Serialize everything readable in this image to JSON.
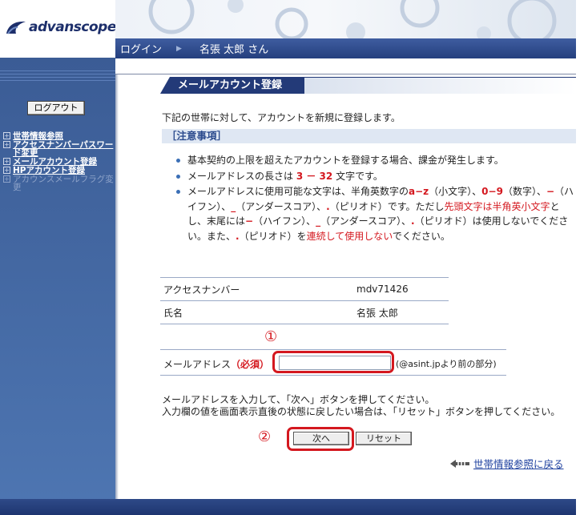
{
  "header": {
    "logo_text": "advanscope",
    "nav_login": "ログイン",
    "user_name": "名張 太郎 さん",
    "accent": "#233a78"
  },
  "sidebar": {
    "logout_label": "ログアウト",
    "items": [
      {
        "label": "世帯情報参照",
        "enabled": true
      },
      {
        "label": "アクセスナンバーパスワード変更",
        "enabled": true
      },
      {
        "label": "メールアカウント登録",
        "enabled": true
      },
      {
        "label": "HPアカウント登録",
        "enabled": true
      },
      {
        "label": "アカウンスメールフラグ変更",
        "enabled": false
      }
    ]
  },
  "main": {
    "title": "メールアカウント登録",
    "intro": "下記の世帯に対して、アカウントを新規に登録します。",
    "notice_heading": "［注意事項］",
    "notices": {
      "n1": "基本契約の上限を超えたアカウントを登録する場合、課金が発生します。",
      "n2_pre": "メールアドレスの長さは",
      "n2_val": "3 － 32",
      "n2_post": "文字です。",
      "n3_a": "メールアドレスに使用可能な文字は、半角英数字の",
      "n3_az": "a−z",
      "n3_b": "（小文字）、",
      "n3_09": "0−9",
      "n3_c": "（数字）、",
      "n3_hy": "−",
      "n3_d": "（ハイフン）、",
      "n3_us": "_",
      "n3_e": "（アンダースコア）、",
      "n3_dot": ".",
      "n3_f": "（ピリオド）です。ただし",
      "n3_head": "先頭文字は半角英小文字",
      "n3_g": "とし、末尾には",
      "n3_hy2": "−",
      "n3_h": "（ハイフン）、",
      "n3_us2": "_",
      "n3_i": "（アンダースコア）、",
      "n3_dot2": ".",
      "n3_j": "（ピリオド）は使用しないでください。また、",
      "n3_dot3": ".",
      "n3_k": "（ピリオド）を",
      "n3_cont": "連続して使用しない",
      "n3_l": "でください。"
    },
    "info": {
      "access_label": "アクセスナンバー",
      "access_value": "mdv71426",
      "name_label": "氏名",
      "name_value": "名張 太郎"
    },
    "mail": {
      "label": "メールアドレス",
      "required": "（必須）",
      "value": "",
      "hint": "(@asint.jpより前の部分)"
    },
    "markers": {
      "one": "①",
      "two": "②"
    },
    "instructions": {
      "line1": "メールアドレスを入力して、「次へ」ボタンを押してください。",
      "line2": "入力欄の値を画面表示直後の状態に戻したい場合は、「リセット」ボタンを押してください。"
    },
    "buttons": {
      "next": "次へ",
      "reset": "リセット"
    },
    "back_link": "世帯情報参照に戻る"
  }
}
